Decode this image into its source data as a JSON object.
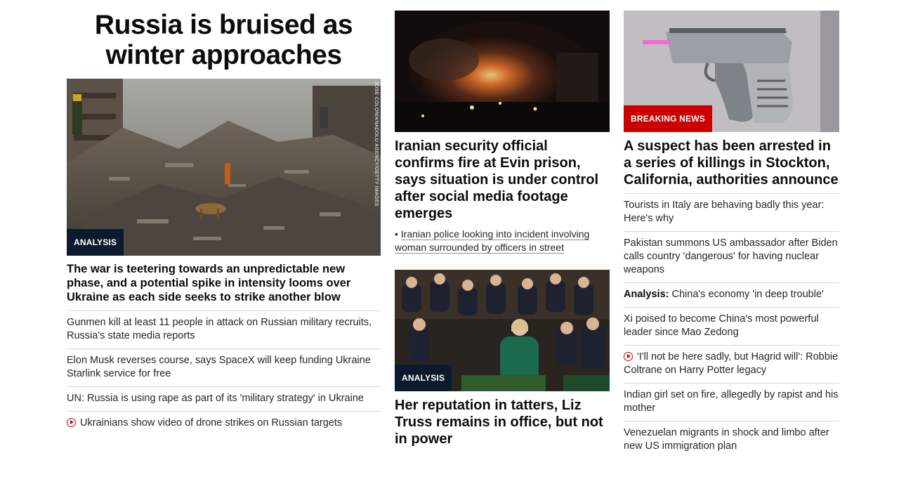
{
  "col1": {
    "section_title": "Russia is bruised as winter approaches",
    "lead_badge": "ANALYSIS",
    "photo_credit": "JOSE COLON/ANADOLU AGENCY/GETTY IMAGES",
    "lead_headline": "The war is teetering towards an unpredictable new phase, and a potential spike in intensity looms over Ukraine as each side seeks to strike another blow",
    "items": [
      "Gunmen kill at least 11 people in attack on Russian military recruits, Russia's state media reports",
      "Elon Musk reverses course, says SpaceX will keep funding Ukraine Starlink service for free",
      "UN: Russia is using rape as part of its 'military strategy' in Ukraine",
      "Ukrainians show video of drone strikes on Russian targets"
    ]
  },
  "col2": {
    "story1_headline": "Iranian security official confirms fire at Evin prison, says situation is under control after social media footage emerges",
    "story1_related": "Iranian police looking into incident involving woman surrounded by officers in street",
    "story2_badge": "ANALYSIS",
    "story2_headline": "Her reputation in tatters, Liz Truss remains in office, but not in power"
  },
  "col3": {
    "badge": "BREAKING NEWS",
    "headline": "A suspect has been arrested in a series of killings in Stockton, California, authorities announce",
    "items": [
      {
        "prefix": "",
        "text": "Tourists in Italy are behaving badly this year: Here's why",
        "video": false
      },
      {
        "prefix": "",
        "text": "Pakistan summons US ambassador after Biden calls country 'dangerous' for having nuclear weapons",
        "video": false
      },
      {
        "prefix": "Analysis:",
        "text": " China's economy 'in deep trouble'",
        "video": false
      },
      {
        "prefix": "",
        "text": "Xi poised to become China's most powerful leader since Mao Zedong",
        "video": false
      },
      {
        "prefix": "",
        "text": "'I'll not be here sadly, but Hagrid will': Robbie Coltrane on Harry Potter legacy",
        "video": true
      },
      {
        "prefix": "",
        "text": "Indian girl set on fire, allegedly by rapist and his mother",
        "video": false
      },
      {
        "prefix": "",
        "text": "Venezuelan migrants in shock and limbo after new US immigration plan",
        "video": false
      }
    ]
  },
  "colors": {
    "breaking": "#cc0000",
    "analysis_badge": "#0c1a2e",
    "divider": "#d9d9d9"
  }
}
